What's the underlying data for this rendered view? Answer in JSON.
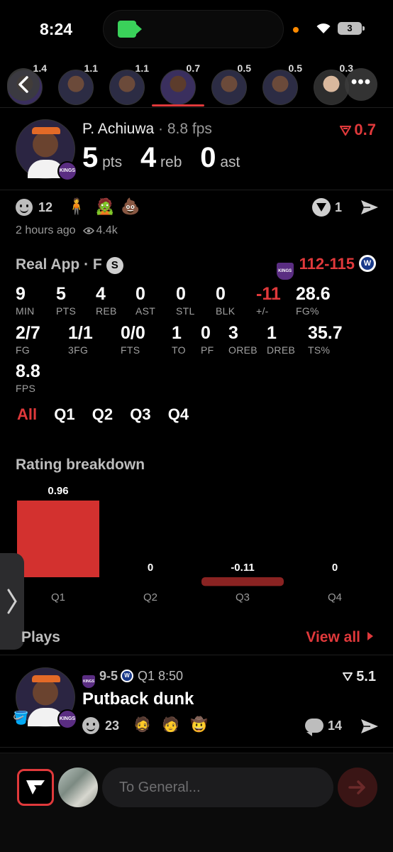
{
  "status_bar": {
    "time": "8:24",
    "battery": "3"
  },
  "player_strip": {
    "items": [
      {
        "value": "1.4",
        "team": "purple"
      },
      {
        "value": "1.1",
        "team": "dark"
      },
      {
        "value": "1.1",
        "team": "dark"
      },
      {
        "value": "0.7",
        "team": "purple"
      },
      {
        "value": "0.5",
        "team": "dark"
      },
      {
        "value": "0.5",
        "team": "dark"
      },
      {
        "value": "0.3",
        "team": "light"
      }
    ],
    "active_index": 3
  },
  "player": {
    "name": "P. Achiuwa",
    "fps": " · 8.8 fps",
    "pts": "5",
    "pts_label": "pts",
    "reb": "4",
    "reb_label": "reb",
    "ast": "0",
    "ast_label": "ast",
    "rating": "0.7",
    "team_badge": "KINGS"
  },
  "reactions": {
    "count": "12",
    "emojis": [
      "🧍",
      "🧟",
      "💩"
    ],
    "v_count": "1",
    "time_ago": "2 hours ago",
    "views": "4.4k"
  },
  "game": {
    "title": "Real App · F",
    "badge": "S",
    "score_home": "112",
    "score_sep": "-",
    "score_away": "115",
    "stats_row1": [
      {
        "v": "9",
        "l": "MIN"
      },
      {
        "v": "5",
        "l": "PTS"
      },
      {
        "v": "4",
        "l": "REB"
      },
      {
        "v": "0",
        "l": "AST"
      },
      {
        "v": "0",
        "l": "STL"
      },
      {
        "v": "0",
        "l": "BLK"
      },
      {
        "v": "-11",
        "l": "+/-",
        "neg": true
      },
      {
        "v": "28.6",
        "l": "FG%"
      }
    ],
    "stats_row2": [
      {
        "v": "2/7",
        "l": "FG"
      },
      {
        "v": "1/1",
        "l": "3FG"
      },
      {
        "v": "0/0",
        "l": "FTS"
      },
      {
        "v": "1",
        "l": "TO"
      },
      {
        "v": "0",
        "l": "PF"
      },
      {
        "v": "3",
        "l": "OREB"
      },
      {
        "v": "1",
        "l": "DREB"
      },
      {
        "v": "35.7",
        "l": "TS%"
      }
    ],
    "stats_row3": [
      {
        "v": "8.8",
        "l": "FPS"
      }
    ],
    "quarter_tabs": [
      "All",
      "Q1",
      "Q2",
      "Q3",
      "Q4"
    ],
    "active_tab": "All"
  },
  "rating_breakdown": {
    "title": "Rating breakdown",
    "chart_data": {
      "type": "bar",
      "categories": [
        "Q1",
        "Q2",
        "Q3",
        "Q4"
      ],
      "values": [
        0.96,
        0,
        -0.11,
        0
      ],
      "value_labels": [
        "0.96",
        "0",
        "-0.11",
        "0"
      ],
      "colors": {
        "positive": "#d3312f",
        "negative": "#8a2322"
      }
    }
  },
  "plays": {
    "title": "Plays",
    "view_all": "View all",
    "items": [
      {
        "score": "9-5",
        "clock": "Q1 8:50",
        "rating": "5.1",
        "title": "Putback dunk",
        "react_count": "23",
        "emojis": [
          "🧔",
          "🧑",
          "🤠"
        ],
        "comments": "14"
      }
    ]
  },
  "composer": {
    "placeholder": "To General..."
  },
  "colors": {
    "accent": "#e0393b",
    "background": "#000000"
  }
}
